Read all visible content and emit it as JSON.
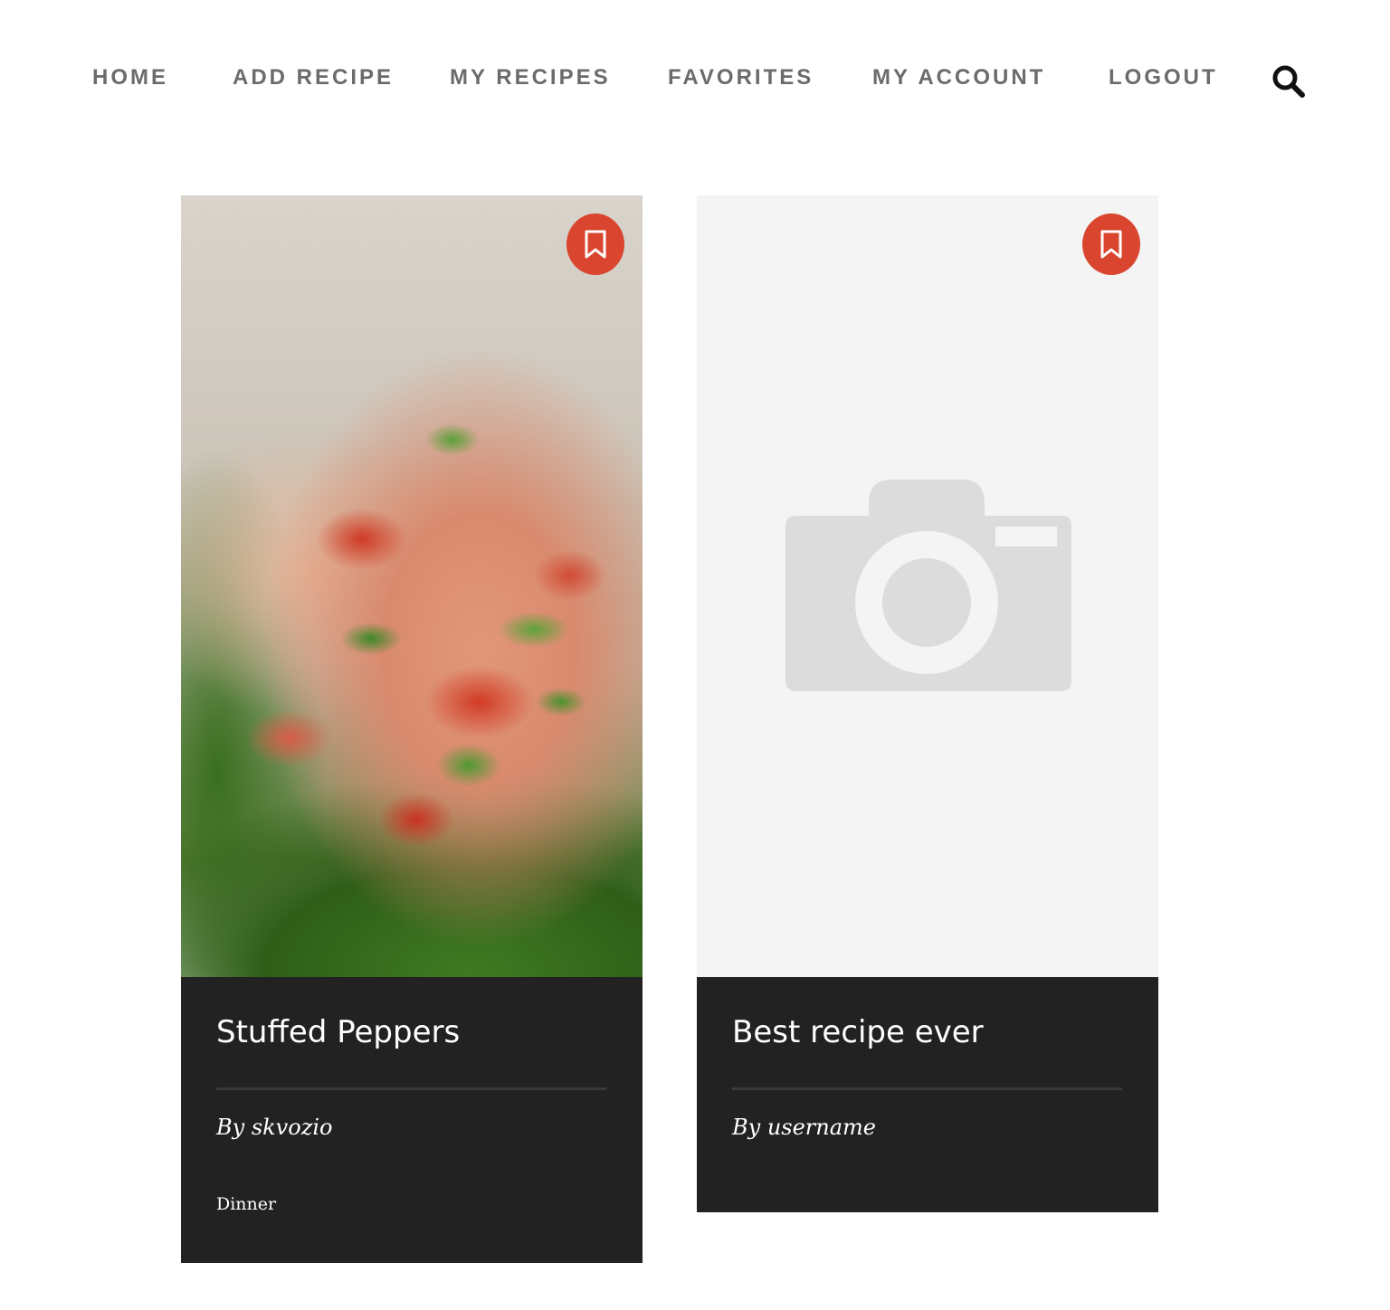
{
  "nav": {
    "links": [
      {
        "label": "HOME"
      },
      {
        "label": "ADD RECIPE"
      },
      {
        "label": "MY RECIPES"
      },
      {
        "label": "FAVORITES"
      },
      {
        "label": "MY ACCOUNT"
      },
      {
        "label": "LOGOUT"
      }
    ],
    "search_icon": "search-icon"
  },
  "recipes": [
    {
      "title": "Stuffed Peppers",
      "author": "By skvozio",
      "category": "Dinner",
      "image": "stuffed-peppers-photo",
      "bookmark_icon": "bookmark-icon"
    },
    {
      "title": "Best recipe ever",
      "author": "By username",
      "image": "camera-placeholder-icon",
      "bookmark_icon": "bookmark-icon"
    }
  ],
  "colors": {
    "accent": "#d9452e",
    "card_body": "#222222",
    "nav_text": "#6b6b6b",
    "placeholder_bg": "#f4f4f4",
    "placeholder_icon": "#dcdcdc"
  }
}
